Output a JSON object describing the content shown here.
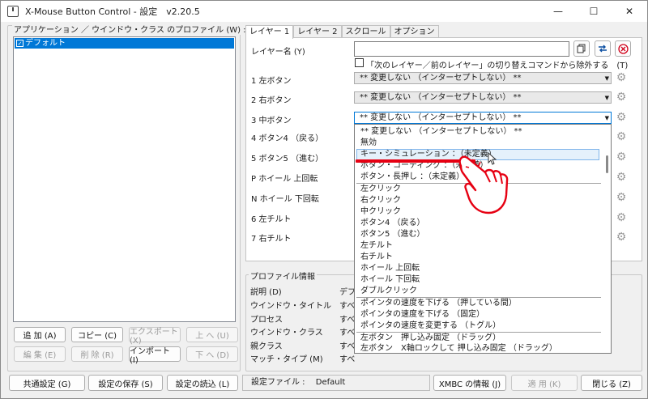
{
  "window": {
    "title": "X-Mouse Button Control - 設定　v2.20.5",
    "minimize": "—",
    "maximize": "☐",
    "close": "✕"
  },
  "profiles": {
    "group_label": "アプリケーション ／ ウインドウ・クラス のプロファイル (W) :",
    "items": [
      {
        "label": "デフォルト",
        "checked": true,
        "selected": true
      }
    ],
    "buttons": {
      "add": "追 加 (A)",
      "copy": "コピー (C)",
      "export": "エクスポート (X)",
      "up": "上 へ (U)",
      "edit": "編 集 (E)",
      "delete": "削 除 (R)",
      "import": "インポート (I)",
      "down": "下 へ (D)"
    }
  },
  "tabs": [
    {
      "label": "レイヤー 1",
      "active": true
    },
    {
      "label": "レイヤー 2",
      "active": false
    },
    {
      "label": "スクロール",
      "active": false
    },
    {
      "label": "オプション",
      "active": false
    }
  ],
  "layer": {
    "name_label": "レイヤー名 (Y)",
    "name_value": "",
    "exclude_label": "「次のレイヤー／前のレイヤー」の切り替えコマンドから除外する　(T)",
    "rows": [
      {
        "label": "1  左ボタン",
        "value": "** 変更しない （インターセプトしない） **"
      },
      {
        "label": "2  右ボタン",
        "value": "** 変更しない （インターセプトしない） **"
      },
      {
        "label": "3  中ボタン",
        "value": "** 変更しない （インターセプトしない） **"
      },
      {
        "label": "4  ボタン4 （戻る）",
        "value": ""
      },
      {
        "label": "5  ボタン5 （進む）",
        "value": ""
      },
      {
        "label": "P  ホイール 上回転",
        "value": ""
      },
      {
        "label": "N  ホイール 下回転",
        "value": ""
      },
      {
        "label": "6  左チルト",
        "value": ""
      },
      {
        "label": "7  右チルト",
        "value": ""
      }
    ]
  },
  "dropdown": {
    "highlighted_index": 2,
    "items": [
      "** 変更しない （インターセプトしない） **",
      "無効",
      "キー・シミュレーション ：（未定義）",
      "ボタン・コーディング ：（未定義）",
      "ボタン・長押し ：（未定義）",
      "左クリック",
      "右クリック",
      "中クリック",
      "ボタン4 （戻る）",
      "ボタン5 （進む）",
      "左チルト",
      "右チルト",
      "ホイール 上回転",
      "ホイール 下回転",
      "ダブルクリック",
      "ポインタの速度を下げる （押している間）",
      "ポインタの速度を下げる （固定）",
      "ポインタの速度を変更する （トグル）",
      "左ボタン　押し込み固定 （ドラッグ）",
      "左ボタン　X軸ロックして 押し込み固定 （ドラッグ）"
    ]
  },
  "profile_info": {
    "group_label": "プロファイル情報",
    "rows": [
      {
        "label": "説明 (D)",
        "value": "デフォ"
      },
      {
        "label": "ウインドウ・タイトル",
        "value": "すべ"
      },
      {
        "label": "プロセス",
        "value": "すべ"
      },
      {
        "label": "ウインドウ・クラス",
        "value": "すべ"
      },
      {
        "label": "親クラス",
        "value": "すべ"
      },
      {
        "label": "マッチ・タイプ (M)",
        "value": "すべ"
      }
    ]
  },
  "footer": {
    "common_settings": "共通設定 (G)",
    "save_settings": "設定の保存 (S)",
    "load_settings": "設定の読込 (L)",
    "settings_file_label": "設定ファイル :",
    "settings_file_value": "Default",
    "xmbc_info": "XMBC の情報 (J)",
    "apply": "適 用 (K)",
    "close": "閉じる (Z)"
  },
  "colors": {
    "selection": "#0078d7",
    "highlight": "#e5f1fb",
    "annotation_red": "#e60012"
  }
}
